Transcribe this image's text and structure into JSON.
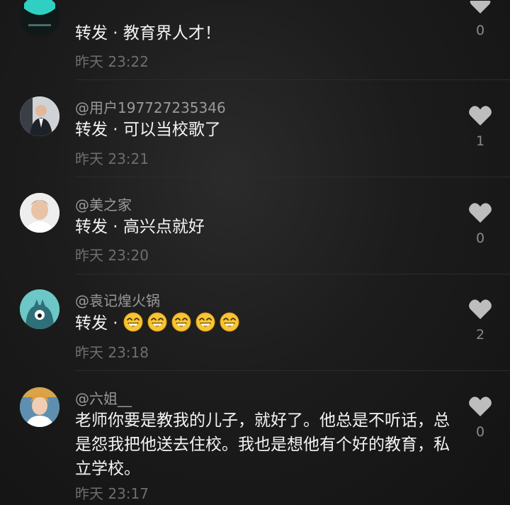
{
  "comments": [
    {
      "author": "",
      "text": "转发 · 教育界人才！",
      "time": "昨天 23:22",
      "likes": "0",
      "avatar_icon": "teal-logo-avatar"
    },
    {
      "author": "@用户197727235346",
      "text": "转发 · 可以当校歌了",
      "time": "昨天 23:21",
      "likes": "1",
      "avatar_icon": "man-in-suit-avatar"
    },
    {
      "author": "@美之家",
      "text": "转发 · 高兴点就好",
      "time": "昨天 23:20",
      "likes": "0",
      "avatar_icon": "man-portrait-avatar"
    },
    {
      "author": "@袁记煌火锅",
      "text": "转发 · ",
      "emojis": [
        "grinning-emoji",
        "grinning-emoji",
        "grinning-emoji",
        "grinning-emoji",
        "grinning-emoji"
      ],
      "time": "昨天 23:18",
      "likes": "2",
      "avatar_icon": "teal-monster-avatar"
    },
    {
      "author": "@六姐__",
      "text": "老师你要是教我的儿子，就好了。他总是不听话，总是怨我把他送去住校。我也是想他有个好的教育，私立学校。",
      "time": "昨天 23:17",
      "likes": "0",
      "avatar_icon": "woman-portrait-avatar"
    }
  ],
  "colors": {
    "author": "#9a9a9a",
    "time": "#6e6e6e",
    "heart": "#bdbdbd",
    "emoji": "#f7c531"
  }
}
